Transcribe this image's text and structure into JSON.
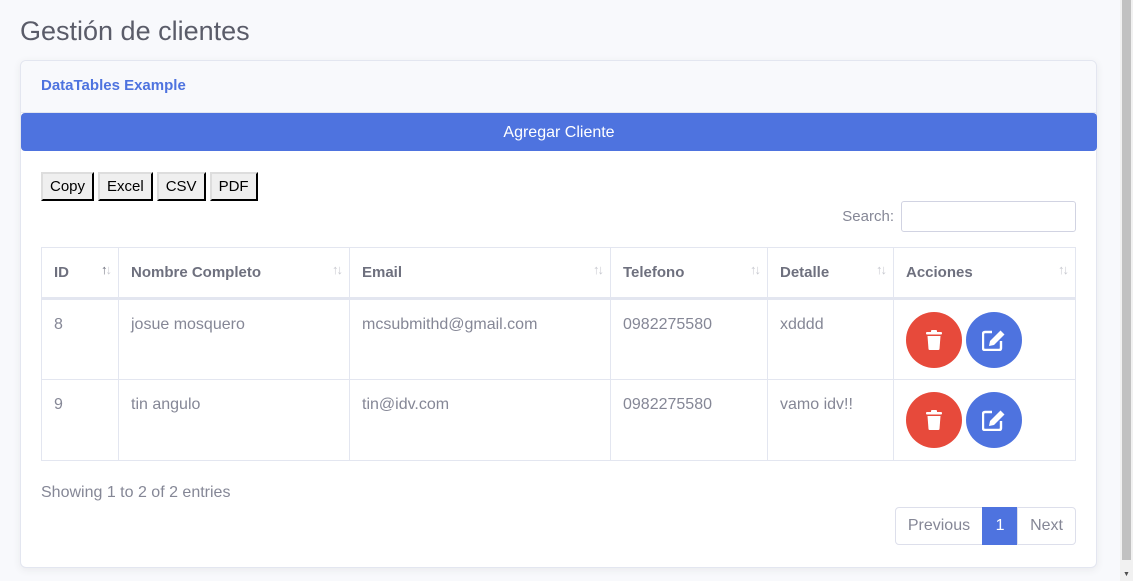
{
  "page": {
    "title": "Gestión de clientes"
  },
  "card": {
    "header_title": "DataTables Example",
    "add_button_label": "Agregar Cliente"
  },
  "export_buttons": [
    "Copy",
    "Excel",
    "CSV",
    "PDF"
  ],
  "search": {
    "label": "Search:",
    "value": ""
  },
  "table": {
    "columns": [
      "ID",
      "Nombre Completo",
      "Email",
      "Telefono",
      "Detalle",
      "Acciones"
    ],
    "sorted_column": "ID",
    "rows": [
      {
        "id": "8",
        "nombre": "josue mosquero",
        "email": "mcsubmithd@gmail.com",
        "telefono": "0982275580",
        "detalle": "xdddd"
      },
      {
        "id": "9",
        "nombre": "tin angulo",
        "email": "tin@idv.com",
        "telefono": "0982275580",
        "detalle": "vamo idv!!"
      }
    ]
  },
  "info": "Showing 1 to 2 of 2 entries",
  "pagination": {
    "previous": "Previous",
    "current": "1",
    "next": "Next"
  },
  "icons": {
    "delete": "trash-icon",
    "edit": "edit-icon"
  },
  "colors": {
    "primary": "#4e73df",
    "danger": "#e74a3b"
  }
}
